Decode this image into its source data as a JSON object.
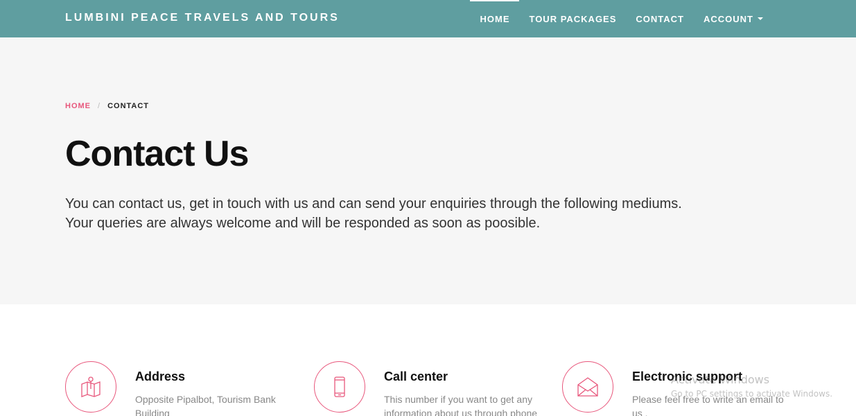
{
  "brand": "LUMBINI PEACE TRAVELS AND TOURS",
  "nav": {
    "home": "HOME",
    "tour_packages": "TOUR PACKAGES",
    "contact": "CONTACT",
    "account": "ACCOUNT"
  },
  "breadcrumb": {
    "home": "HOME",
    "separator": "/",
    "current": "CONTACT"
  },
  "hero": {
    "title": "Contact Us",
    "line1": "You can contact us, get in touch with us and can send your enquiries through the following mediums.",
    "line2": "Your queries are always welcome and will be responded as soon as poosible."
  },
  "features": [
    {
      "icon": "map-pin-icon",
      "title": "Address",
      "text": "Opposite Pipalbot, Tourism Bank Building"
    },
    {
      "icon": "mobile-phone-icon",
      "title": "Call center",
      "text": "This number if you want to get any information about us through phone"
    },
    {
      "icon": "envelope-icon",
      "title": "Electronic support",
      "text": "Please feel free to write an email to us ."
    }
  ],
  "watermark": {
    "line1": "Activate Windows",
    "line2": "Go to PC settings to activate Windows."
  },
  "colors": {
    "navbar": "#5f9ea0",
    "accent": "#e8577c",
    "hero_bg": "#f6f6f6"
  }
}
